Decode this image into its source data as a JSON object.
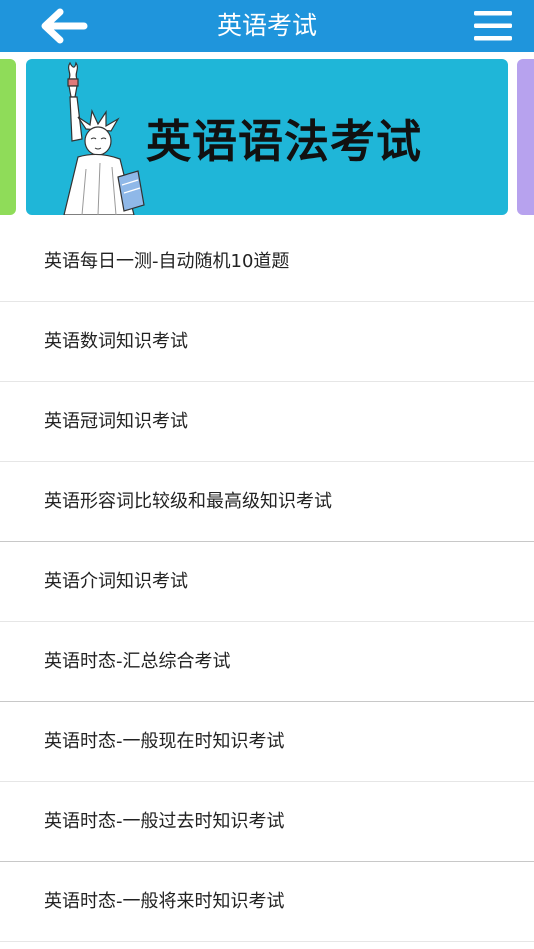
{
  "header": {
    "title": "英语考试",
    "back_icon": "arrow-left-icon",
    "menu_icon": "hamburger-menu-icon",
    "background_color": "#1f95dc"
  },
  "banner": {
    "text": "英语语法考试",
    "background_color": "#1fb6d8",
    "prev_slide_color": "#8fdc59",
    "next_slide_color": "#b7a2ee",
    "illustration": "statue-of-liberty-illustration"
  },
  "exams": [
    {
      "label": "英语每日一测-自动随机10道题"
    },
    {
      "label": "英语数词知识考试"
    },
    {
      "label": "英语冠词知识考试"
    },
    {
      "label": "英语形容词比较级和最高级知识考试"
    },
    {
      "label": "英语介词知识考试"
    },
    {
      "label": "英语时态-汇总综合考试"
    },
    {
      "label": "英语时态-一般现在时知识考试"
    },
    {
      "label": "英语时态-一般过去时知识考试"
    },
    {
      "label": "英语时态-一般将来时知识考试"
    }
  ]
}
